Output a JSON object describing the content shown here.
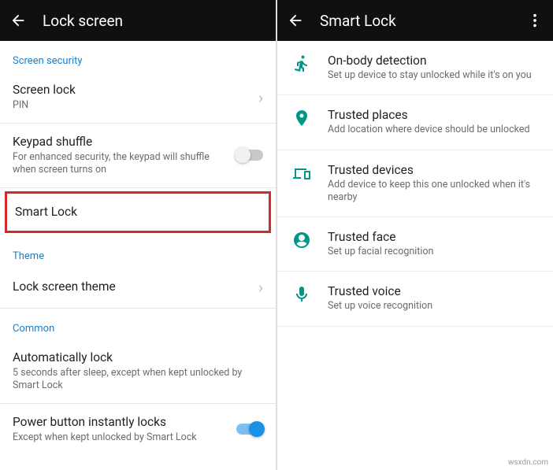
{
  "left": {
    "title": "Lock screen",
    "section_security": "Screen security",
    "screen_lock": {
      "title": "Screen lock",
      "sub": "PIN"
    },
    "keypad_shuffle": {
      "title": "Keypad shuffle",
      "sub": "For enhanced security, the keypad will shuffle when screen turns on",
      "on": false
    },
    "smart_lock": {
      "title": "Smart Lock"
    },
    "section_theme": "Theme",
    "theme_row": {
      "title": "Lock screen theme"
    },
    "section_common": "Common",
    "auto_lock": {
      "title": "Automatically lock",
      "sub": "5 seconds after sleep, except when kept unlocked by Smart Lock"
    },
    "power_lock": {
      "title": "Power button instantly locks",
      "sub": "Except when kept unlocked by Smart Lock",
      "on": true
    }
  },
  "right": {
    "title": "Smart Lock",
    "items": [
      {
        "title": "On-body detection",
        "sub": "Set up device to stay unlocked while it's on you"
      },
      {
        "title": "Trusted places",
        "sub": "Add location where device should be unlocked"
      },
      {
        "title": "Trusted devices",
        "sub": "Add device to keep this one unlocked when it's nearby"
      },
      {
        "title": "Trusted face",
        "sub": "Set up facial recognition"
      },
      {
        "title": "Trusted voice",
        "sub": "Set up voice recognition"
      }
    ]
  },
  "watermark": "wsxdn.com"
}
